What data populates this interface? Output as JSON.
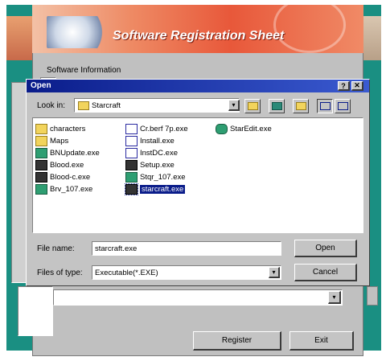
{
  "banner": {
    "title": "Software Registration Sheet"
  },
  "background_window": {
    "section_label": "Software Information",
    "register_button": "Register",
    "exit_button": "Exit"
  },
  "dialog": {
    "title": "Open",
    "help_glyph": "?",
    "close_glyph": "✕",
    "look_in_label": "Look in:",
    "look_in_value": "Starcraft",
    "file_name_label": "File name:",
    "file_name_value": "starcraft.exe",
    "files_of_type_label": "Files of type:",
    "files_of_type_value": "Executable(*.EXE)",
    "open_button": "Open",
    "cancel_button": "Cancel",
    "files": [
      {
        "name": "characters",
        "icon": "folder-icon"
      },
      {
        "name": "Maps",
        "icon": "folder-icon"
      },
      {
        "name": "BNUpdate.exe",
        "icon": "exe-icon"
      },
      {
        "name": "Blood.exe",
        "icon": "exe-icon"
      },
      {
        "name": "Blood-c.exe",
        "icon": "exe-icon"
      },
      {
        "name": "Brv_107.exe",
        "icon": "exe-icon"
      },
      {
        "name": "Cr.berf 7p.exe",
        "icon": "exe-icon"
      },
      {
        "name": "Install.exe",
        "icon": "exe-icon"
      },
      {
        "name": "InstDC.exe",
        "icon": "exe-icon"
      },
      {
        "name": "Setup.exe",
        "icon": "exe-icon"
      },
      {
        "name": "Stqr_107.exe",
        "icon": "exe-icon"
      },
      {
        "name": "starcraft.exe",
        "icon": "exe-icon",
        "selected": true
      },
      {
        "name": "StarEdit.exe",
        "icon": "exe-icon"
      }
    ]
  },
  "colors": {
    "teal": "#1a8f82",
    "titlebar": "#0a1c8a",
    "selection": "#0a1c8a",
    "banner": "#e8583a"
  }
}
